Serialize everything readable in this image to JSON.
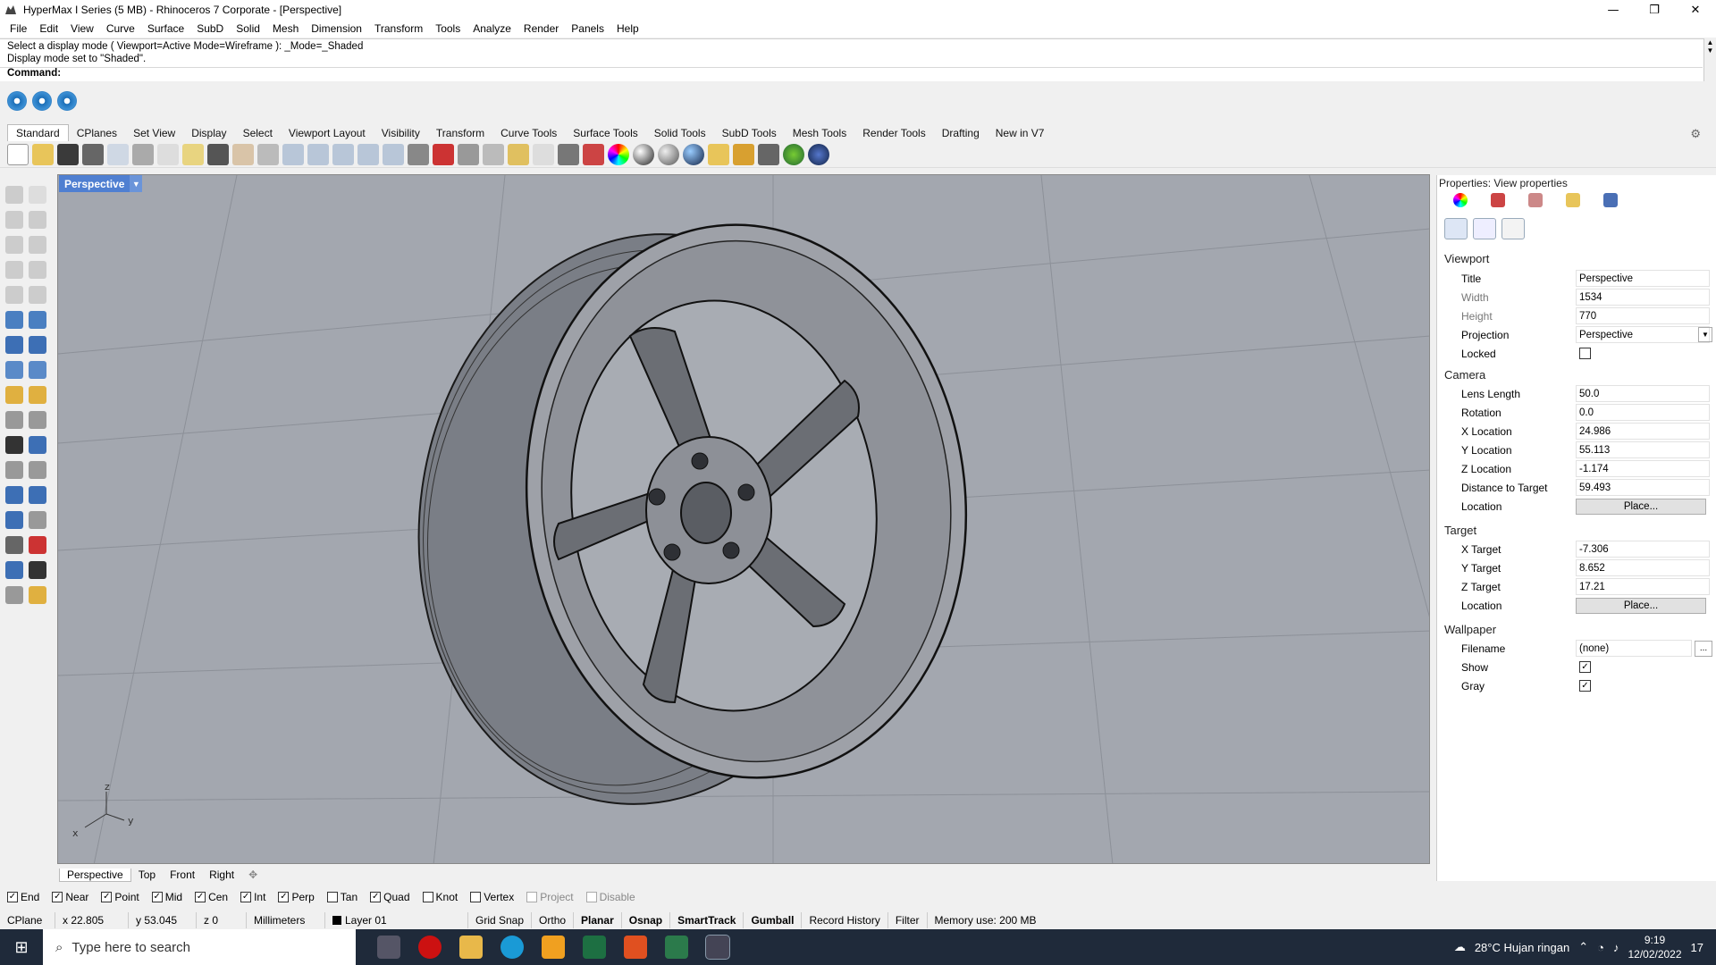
{
  "window": {
    "title": "HyperMax I Series (5 MB) - Rhinoceros 7 Corporate - [Perspective]",
    "controls": [
      "—",
      "❐",
      "✕"
    ]
  },
  "menu": [
    "File",
    "Edit",
    "View",
    "Curve",
    "Surface",
    "SubD",
    "Solid",
    "Mesh",
    "Dimension",
    "Transform",
    "Tools",
    "Analyze",
    "Render",
    "Panels",
    "Help"
  ],
  "command_history": {
    "line1": "Select a display mode ( Viewport=Active  Mode=Wireframe ): _Mode=_Shaded",
    "line2": "Display mode set to \"Shaded\".",
    "prompt": "Command:"
  },
  "toolbar_tabs": [
    "Standard",
    "CPlanes",
    "Set View",
    "Display",
    "Select",
    "Viewport Layout",
    "Visibility",
    "Transform",
    "Curve Tools",
    "Surface Tools",
    "Solid Tools",
    "SubD Tools",
    "Mesh Tools",
    "Render Tools",
    "Drafting",
    "New in V7"
  ],
  "viewport": {
    "name": "Perspective",
    "axis_labels": {
      "z": "z",
      "x": "x",
      "y": "y"
    }
  },
  "viewport_tabs": [
    "Perspective",
    "Top",
    "Front",
    "Right",
    "✥"
  ],
  "osnaps": [
    {
      "label": "End",
      "checked": true
    },
    {
      "label": "Near",
      "checked": true
    },
    {
      "label": "Point",
      "checked": true
    },
    {
      "label": "Mid",
      "checked": true
    },
    {
      "label": "Cen",
      "checked": true
    },
    {
      "label": "Int",
      "checked": true
    },
    {
      "label": "Perp",
      "checked": true
    },
    {
      "label": "Tan",
      "checked": false
    },
    {
      "label": "Quad",
      "checked": true
    },
    {
      "label": "Knot",
      "checked": false
    },
    {
      "label": "Vertex",
      "checked": false
    },
    {
      "label": "Project",
      "checked": false,
      "disabled": true
    },
    {
      "label": "Disable",
      "checked": false,
      "disabled": true
    }
  ],
  "status": {
    "cplane": "CPlane",
    "x": "x 22.805",
    "y": "y 53.045",
    "z": "z 0",
    "units": "Millimeters",
    "layer": "Layer 01",
    "grid_snap": "Grid Snap",
    "ortho": "Ortho",
    "planar": "Planar",
    "osnap": "Osnap",
    "smarttrack": "SmartTrack",
    "gumball": "Gumball",
    "record_history": "Record History",
    "filter": "Filter",
    "memory": "Memory use: 200 MB"
  },
  "properties": {
    "title": "Properties: View properties",
    "viewport_section": "Viewport",
    "title_label": "Title",
    "title_value": "Perspective",
    "width_label": "Width",
    "width_value": "1534",
    "height_label": "Height",
    "height_value": "770",
    "projection_label": "Projection",
    "projection_value": "Perspective",
    "locked_label": "Locked",
    "locked": false,
    "camera_section": "Camera",
    "lens_label": "Lens Length",
    "lens_value": "50.0",
    "rotation_label": "Rotation",
    "rotation_value": "0.0",
    "xloc_label": "X Location",
    "xloc_value": "24.986",
    "yloc_label": "Y Location",
    "yloc_value": "55.113",
    "zloc_label": "Z Location",
    "zloc_value": "-1.174",
    "dist_label": "Distance to Target",
    "dist_value": "59.493",
    "cam_location_label": "Location",
    "cam_place": "Place...",
    "target_section": "Target",
    "xt_label": "X Target",
    "xt_value": "-7.306",
    "yt_label": "Y Target",
    "yt_value": "8.652",
    "zt_label": "Z Target",
    "zt_value": "17.21",
    "tgt_location_label": "Location",
    "tgt_place": "Place...",
    "wallpaper_section": "Wallpaper",
    "filename_label": "Filename",
    "filename_value": "(none)",
    "filename_btn": "...",
    "show_label": "Show",
    "show": true,
    "gray_label": "Gray",
    "gray": true
  },
  "taskbar": {
    "search_placeholder": "Type here to search",
    "weather": "28°C  Hujan ringan",
    "time": "9:19",
    "date": "12/02/2022",
    "notif": "17"
  },
  "colors": {
    "viewport_bg": "#a3a7af",
    "viewport_tab": "#4f7fd1",
    "taskbar": "#1f2a3a"
  }
}
